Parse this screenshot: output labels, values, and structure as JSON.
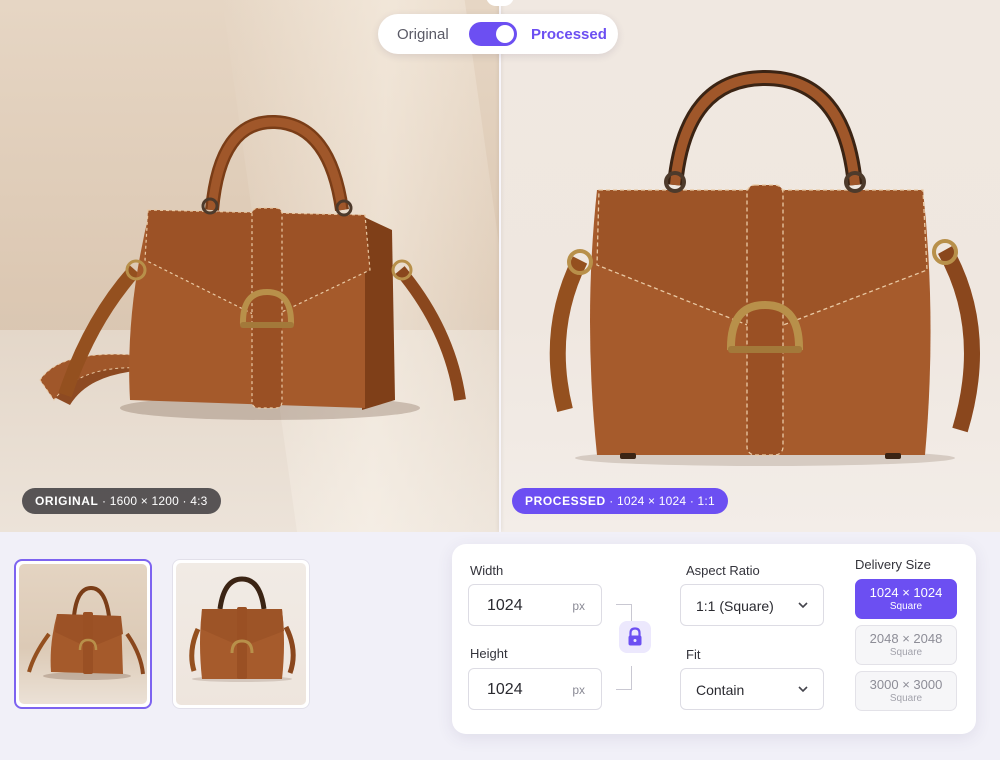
{
  "toggle": {
    "left_label": "Original",
    "right_label": "Processed",
    "state": "processed"
  },
  "badges": {
    "original": {
      "tag": "ORIGINAL",
      "info": " · 1600 × 1200 · 4:3"
    },
    "processed": {
      "tag": "PROCESSED",
      "info": " · 1024 × 1024 · 1:1"
    }
  },
  "thumbnails": [
    {
      "name": "original",
      "selected": true
    },
    {
      "name": "processed",
      "selected": false
    }
  ],
  "settings": {
    "width": {
      "label": "Width",
      "value": "1024",
      "unit": "px"
    },
    "height": {
      "label": "Height",
      "value": "1024",
      "unit": "px"
    },
    "aspect_ratio": {
      "label": "Aspect Ratio",
      "value": "1:1 (Square)"
    },
    "fit": {
      "label": "Fit",
      "value": "Contain"
    },
    "delivery_size": {
      "label": "Delivery Size",
      "options": [
        {
          "size": "1024 × 1024",
          "shape": "Square",
          "selected": true
        },
        {
          "size": "2048 × 2048",
          "shape": "Square",
          "selected": false
        },
        {
          "size": "3000 × 3000",
          "shape": "Square",
          "selected": false
        }
      ]
    }
  },
  "colors": {
    "accent": "#6c4ff2",
    "leather": "#a0572a",
    "hardware": "#b8904a"
  },
  "icons": [
    "lock-icon",
    "chevron-down-icon",
    "handbag-image"
  ]
}
